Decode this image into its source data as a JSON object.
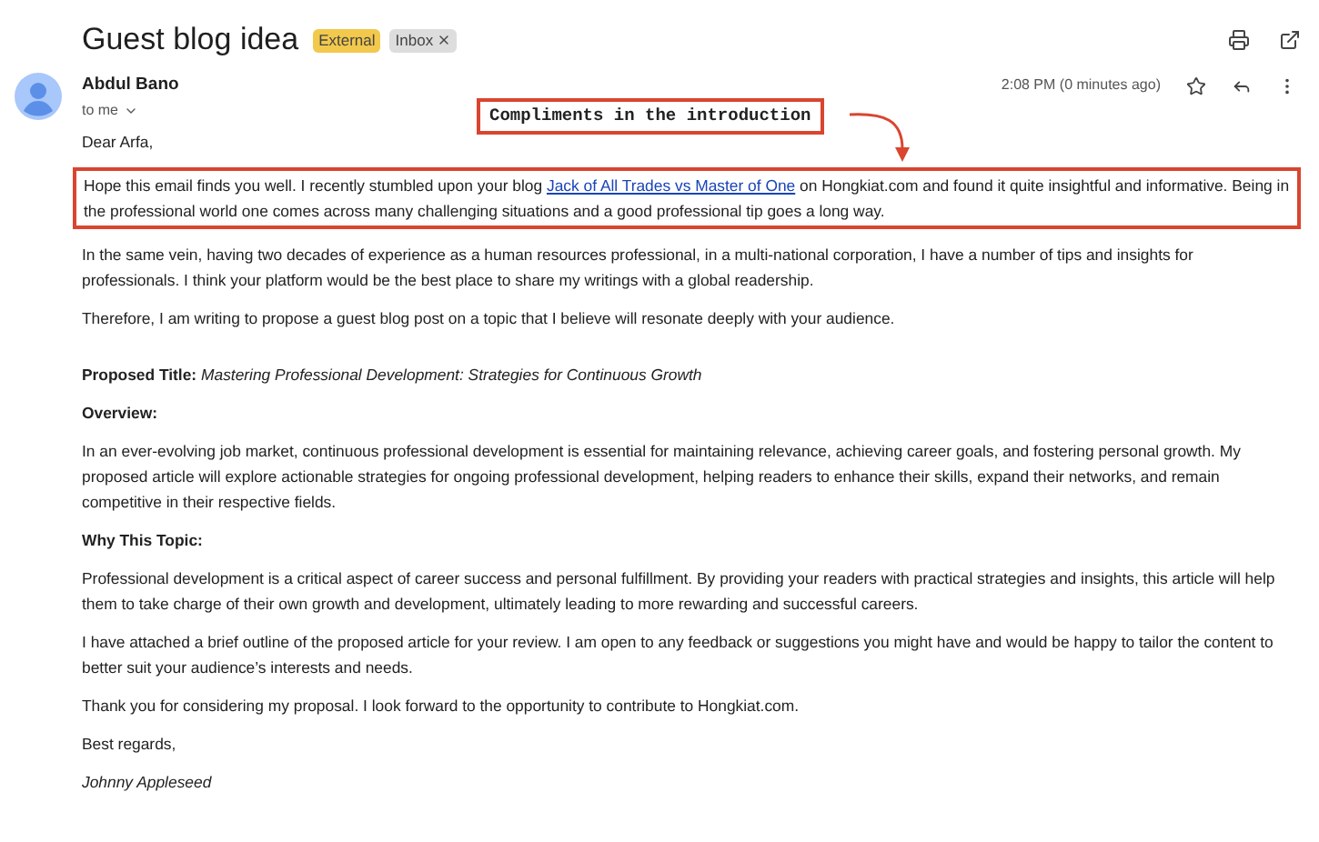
{
  "subject": "Guest blog idea",
  "labels": [
    {
      "text": "External",
      "color": "#f2c94c",
      "removable": false
    },
    {
      "text": "Inbox",
      "color": "#dddddd",
      "removable": true
    }
  ],
  "sender": {
    "name": "Abdul Bano",
    "recipient": "to me",
    "time": "2:08 PM (0 minutes ago)"
  },
  "annotation": "Compliments in the introduction",
  "body": [
    {
      "kind": "text",
      "parts": [
        {
          "kind": "text",
          "text": "Dear Arfa,"
        }
      ]
    },
    {
      "kind": "text",
      "highlighted": true,
      "parts": [
        {
          "kind": "text",
          "text": "Hope this email finds you well. I recently stumbled upon your blog "
        },
        {
          "kind": "link",
          "text": "Jack of All Trades vs Master of One"
        },
        {
          "kind": "text",
          "text": " on Hongkiat.com and found it quite insightful and informative. Being in the professional world one comes across many challenging situations and a good professional tip goes a long way."
        }
      ]
    },
    {
      "kind": "text",
      "parts": [
        {
          "kind": "text",
          "text": "In the same vein, having two decades of experience as a human resources professional, in a multi-national corporation, I have a number of tips and insights for professionals. I think your platform would be the best place to share my writings with a global readership."
        }
      ]
    },
    {
      "kind": "text",
      "parts": [
        {
          "kind": "text",
          "text": "Therefore, I am writing to propose a guest blog post on a topic that I believe will resonate deeply with your audience."
        }
      ]
    },
    {
      "kind": "text",
      "parts": [
        {
          "kind": "rich",
          "text": "**Proposed Title:** *Mastering Professional Development: Strategies for Continuous Growth*"
        }
      ]
    },
    {
      "kind": "heading",
      "parts": [
        {
          "kind": "text",
          "text": "Overview:"
        }
      ]
    },
    {
      "kind": "text",
      "parts": [
        {
          "kind": "text",
          "text": "In an ever-evolving job market, continuous professional development is essential for maintaining relevance, achieving career goals, and fostering personal growth. My proposed article will explore actionable strategies for ongoing professional development, helping readers to enhance their skills, expand their networks, and remain competitive in their respective fields."
        }
      ]
    },
    {
      "kind": "heading",
      "parts": [
        {
          "kind": "text",
          "text": "Why This Topic:"
        }
      ]
    },
    {
      "kind": "text",
      "parts": [
        {
          "kind": "text",
          "text": "Professional development is a critical aspect of career success and personal fulfillment. By providing your readers with practical strategies and insights, this article will help them to take charge of their own growth and development, ultimately leading to more rewarding and successful careers."
        }
      ]
    },
    {
      "kind": "text",
      "parts": [
        {
          "kind": "text",
          "text": "I have attached a brief outline of the proposed article for your review. I am open to any feedback or suggestions you might have and would be happy to tailor the content to better suit your audience’s interests and needs."
        }
      ]
    },
    {
      "kind": "text",
      "parts": [
        {
          "kind": "text",
          "text": "Thank you for considering my proposal. I look forward to the opportunity to contribute to Hongkiat.com."
        }
      ]
    },
    {
      "kind": "text",
      "parts": [
        {
          "kind": "text",
          "text": "Best regards,"
        }
      ]
    },
    {
      "kind": "signature",
      "parts": [
        {
          "kind": "text",
          "text": "Johnny Appleseed"
        }
      ]
    }
  ]
}
